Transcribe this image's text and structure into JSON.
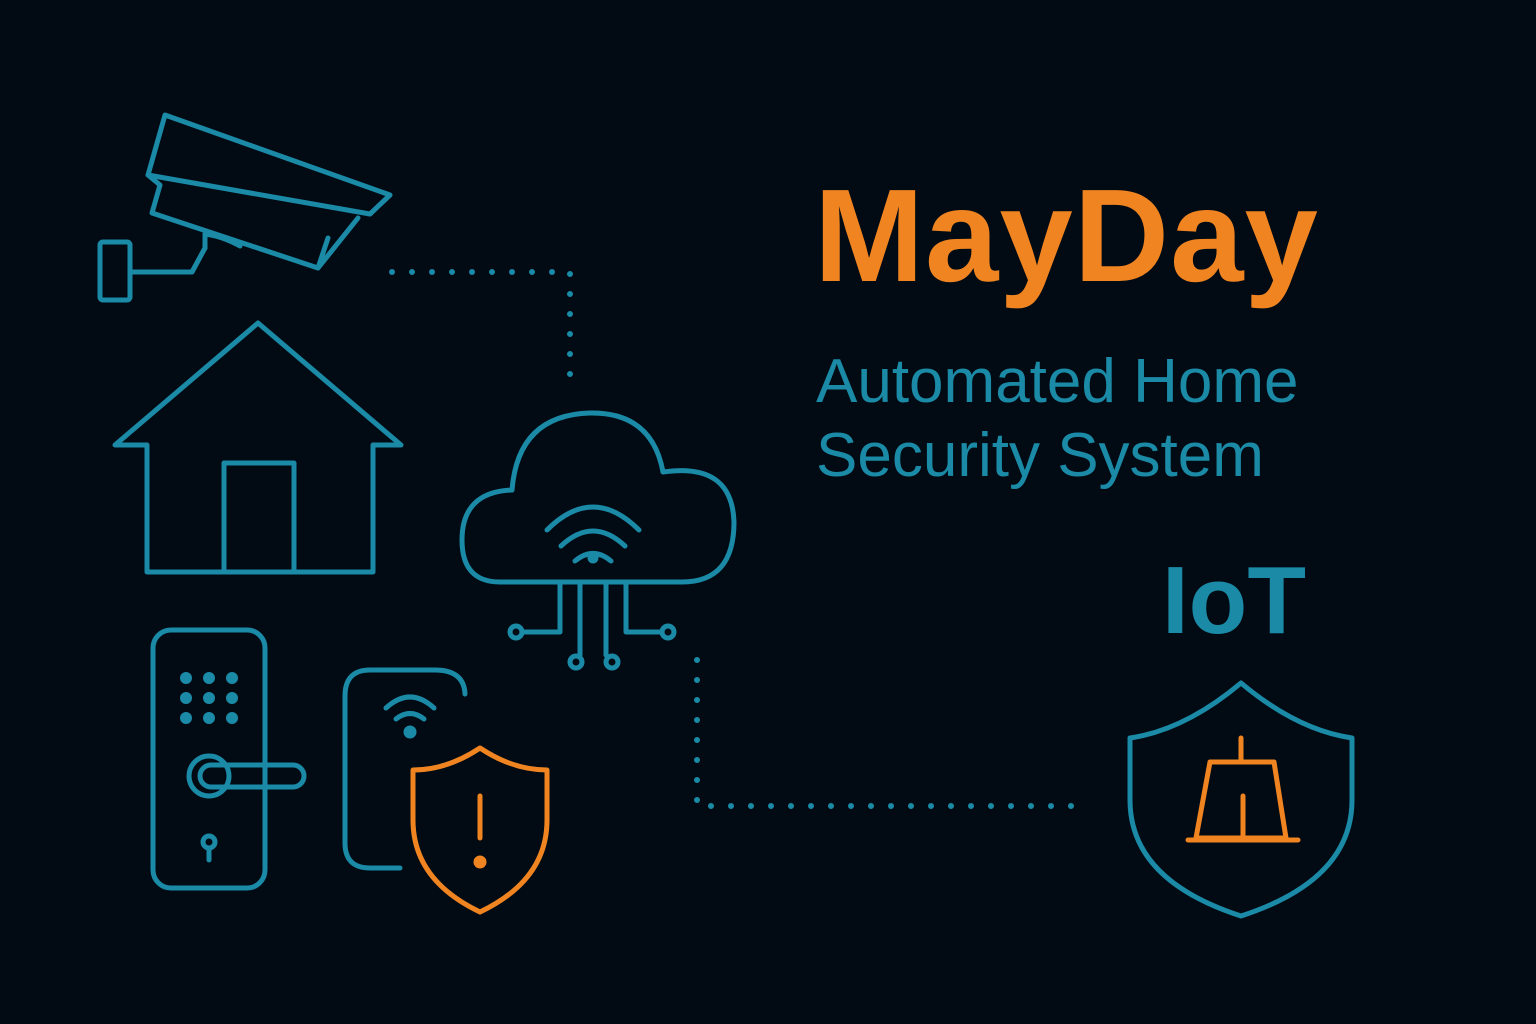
{
  "title": "MayDay",
  "subtitle_line1": "Automated Home",
  "subtitle_line2": "Security System",
  "tag": "IoT",
  "colors": {
    "background": "#020b14",
    "accent_orange": "#f08421",
    "accent_blue": "#1b8aa6"
  },
  "icons": [
    "security-camera-icon",
    "house-icon",
    "cloud-wifi-icon",
    "smart-door-lock-icon",
    "smart-tag-icon",
    "alert-shield-icon",
    "alarm-shield-icon"
  ]
}
